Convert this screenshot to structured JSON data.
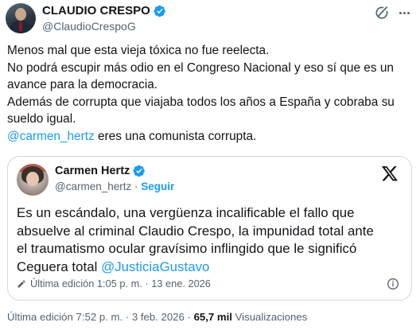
{
  "author": {
    "display_name": "CLAUDIO CRESPO",
    "handle": "@ClaudioCrespoG",
    "avatar_icon": "profile-photo"
  },
  "tweet": {
    "lines": [
      "Menos mal que esta vieja tóxica no fue reelecta.",
      "No podrá escupir más odio en el Congreso Nacional y eso sí que es un",
      "avance para la democracia.",
      "Además de corrupta que viajaba todos los años a España y cobraba su",
      "sueldo igual."
    ],
    "mention": "@carmen_hertz",
    "mention_suffix": " eres una comunista corrupta."
  },
  "quote": {
    "display_name": "Carmen Hertz",
    "handle": "@carmen_hertz",
    "separator": " · ",
    "follow_label": "Seguir",
    "lines": [
      "Es un escándalo, una vergüenza incalificable el fallo que",
      "absuelve al criminal Claudio Crespo, la impunidad total ante",
      "el traumatismo ocular gravísimo inflingido que le significó"
    ],
    "last_line_prefix": "Ceguera total ",
    "last_line_mention": "@JusticiaGustavo",
    "edit_label": "Última edición 1:05 p. m. · 13 ene. 2026"
  },
  "meta": {
    "edit_label": "Última edición 7:52 p. m. · 3 feb. 2026 · ",
    "views_count": "65,7 mil",
    "views_label": " Visualizaciones"
  },
  "colors": {
    "accent": "#1d9bf0",
    "text": "#0f1419",
    "secondary": "#536471",
    "border": "#cfd9de"
  }
}
